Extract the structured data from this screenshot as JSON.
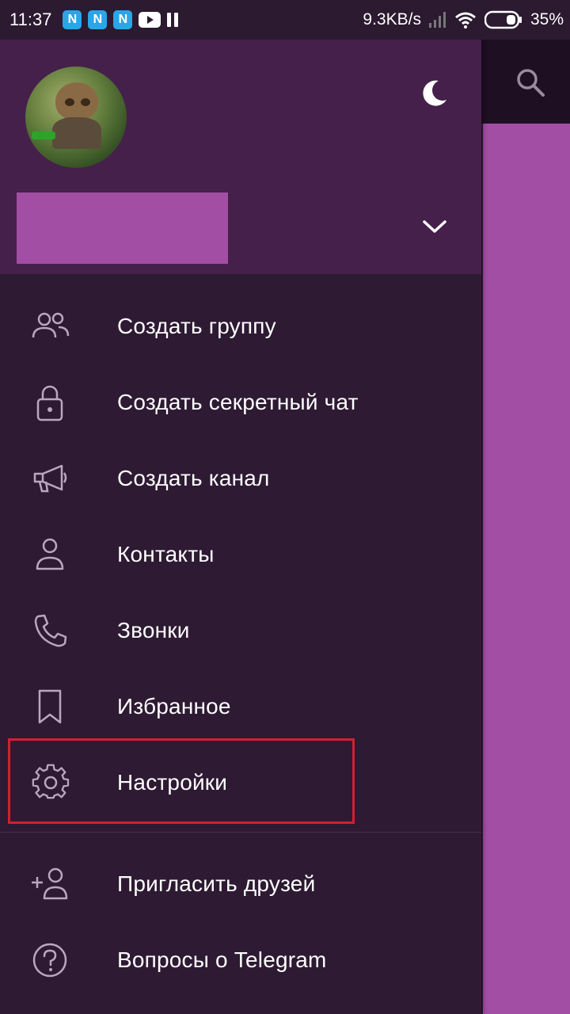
{
  "status_bar": {
    "time": "11:37",
    "notification_icons": [
      "N",
      "N",
      "N"
    ],
    "net_speed": "9.3KB/s",
    "battery": "35%"
  },
  "header": {
    "avatar_icon": "profile-photo",
    "theme_icon": "moon-icon",
    "expand_icon": "chevron-down-icon"
  },
  "menu": {
    "items": [
      {
        "label": "Создать группу",
        "icon": "group-icon"
      },
      {
        "label": "Создать секретный чат",
        "icon": "lock-icon"
      },
      {
        "label": "Создать канал",
        "icon": "megaphone-icon"
      },
      {
        "label": "Контакты",
        "icon": "person-icon"
      },
      {
        "label": "Звонки",
        "icon": "phone-icon"
      },
      {
        "label": "Избранное",
        "icon": "bookmark-icon"
      },
      {
        "label": "Настройки",
        "icon": "gear-icon"
      }
    ],
    "secondary": [
      {
        "label": "Пригласить друзей",
        "icon": "add-person-icon"
      },
      {
        "label": "Вопросы о Telegram",
        "icon": "question-icon"
      }
    ]
  },
  "colors": {
    "drawer_bg": "#2e1a33",
    "header_bg": "#45204b",
    "accent_pink": "#a34ea5",
    "highlight_red": "#d22030"
  }
}
